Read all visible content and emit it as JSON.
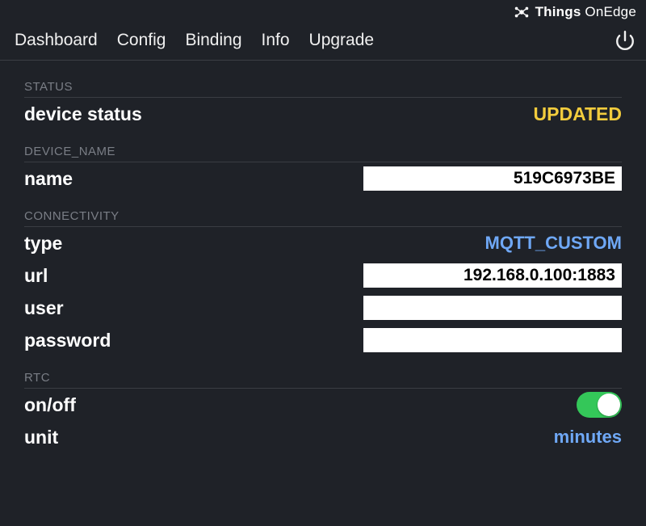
{
  "brand": {
    "part1": "Things",
    "part2": " OnEdge"
  },
  "nav": {
    "items": [
      "Dashboard",
      "Config",
      "Binding",
      "Info",
      "Upgrade"
    ]
  },
  "sections": {
    "status": {
      "header": "STATUS",
      "row_label": "device status",
      "value": "UPDATED"
    },
    "device_name": {
      "header": "DEVICE_NAME",
      "row_label": "name",
      "value": "519C6973BE"
    },
    "connectivity": {
      "header": "CONNECTIVITY",
      "type_label": "type",
      "type_value": "MQTT_CUSTOM",
      "url_label": "url",
      "url_value": "192.168.0.100:1883",
      "user_label": "user",
      "user_value": "",
      "password_label": "password",
      "password_value": ""
    },
    "rtc": {
      "header": "RTC",
      "onoff_label": "on/off",
      "onoff_value": true,
      "unit_label": "unit",
      "unit_value": "minutes"
    }
  }
}
